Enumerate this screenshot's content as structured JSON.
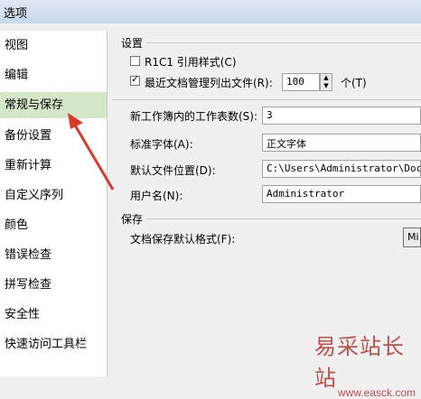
{
  "window": {
    "title": "选项"
  },
  "sidebar": {
    "items": [
      {
        "label": "视图"
      },
      {
        "label": "编辑"
      },
      {
        "label": "常规与保存"
      },
      {
        "label": "备份设置"
      },
      {
        "label": "重新计算"
      },
      {
        "label": "自定义序列"
      },
      {
        "label": "颜色"
      },
      {
        "label": "错误检查"
      },
      {
        "label": "拼写检查"
      },
      {
        "label": "安全性"
      },
      {
        "label": "快速访问工具栏"
      }
    ],
    "selected_index": 2
  },
  "settings": {
    "header": "设置",
    "r1c1": {
      "label": "R1C1 引用样式(C)",
      "checked": false
    },
    "recent": {
      "label": "最近文档管理列出文件(R):",
      "checked": true,
      "value": "100",
      "unit": "个(T)"
    },
    "sheets": {
      "label": "新工作簿内的工作表数(S):",
      "value": "3"
    },
    "font": {
      "label": "标准字体(A):",
      "value": "正文字体"
    },
    "location": {
      "label": "默认文件位置(D):",
      "value": "C:\\Users\\Administrator\\Documents"
    },
    "username": {
      "label": "用户名(N):",
      "value": "Administrator"
    }
  },
  "save": {
    "header": "保存",
    "format": {
      "label": "文档保存默认格式(F):",
      "value": "Mi"
    }
  },
  "watermark": {
    "text": "易采站长站",
    "url": "www.easck.com"
  },
  "colors": {
    "selected_bg": "#d4e7c7",
    "arrow": "#d93a2b",
    "watermark": "#c0504d"
  }
}
